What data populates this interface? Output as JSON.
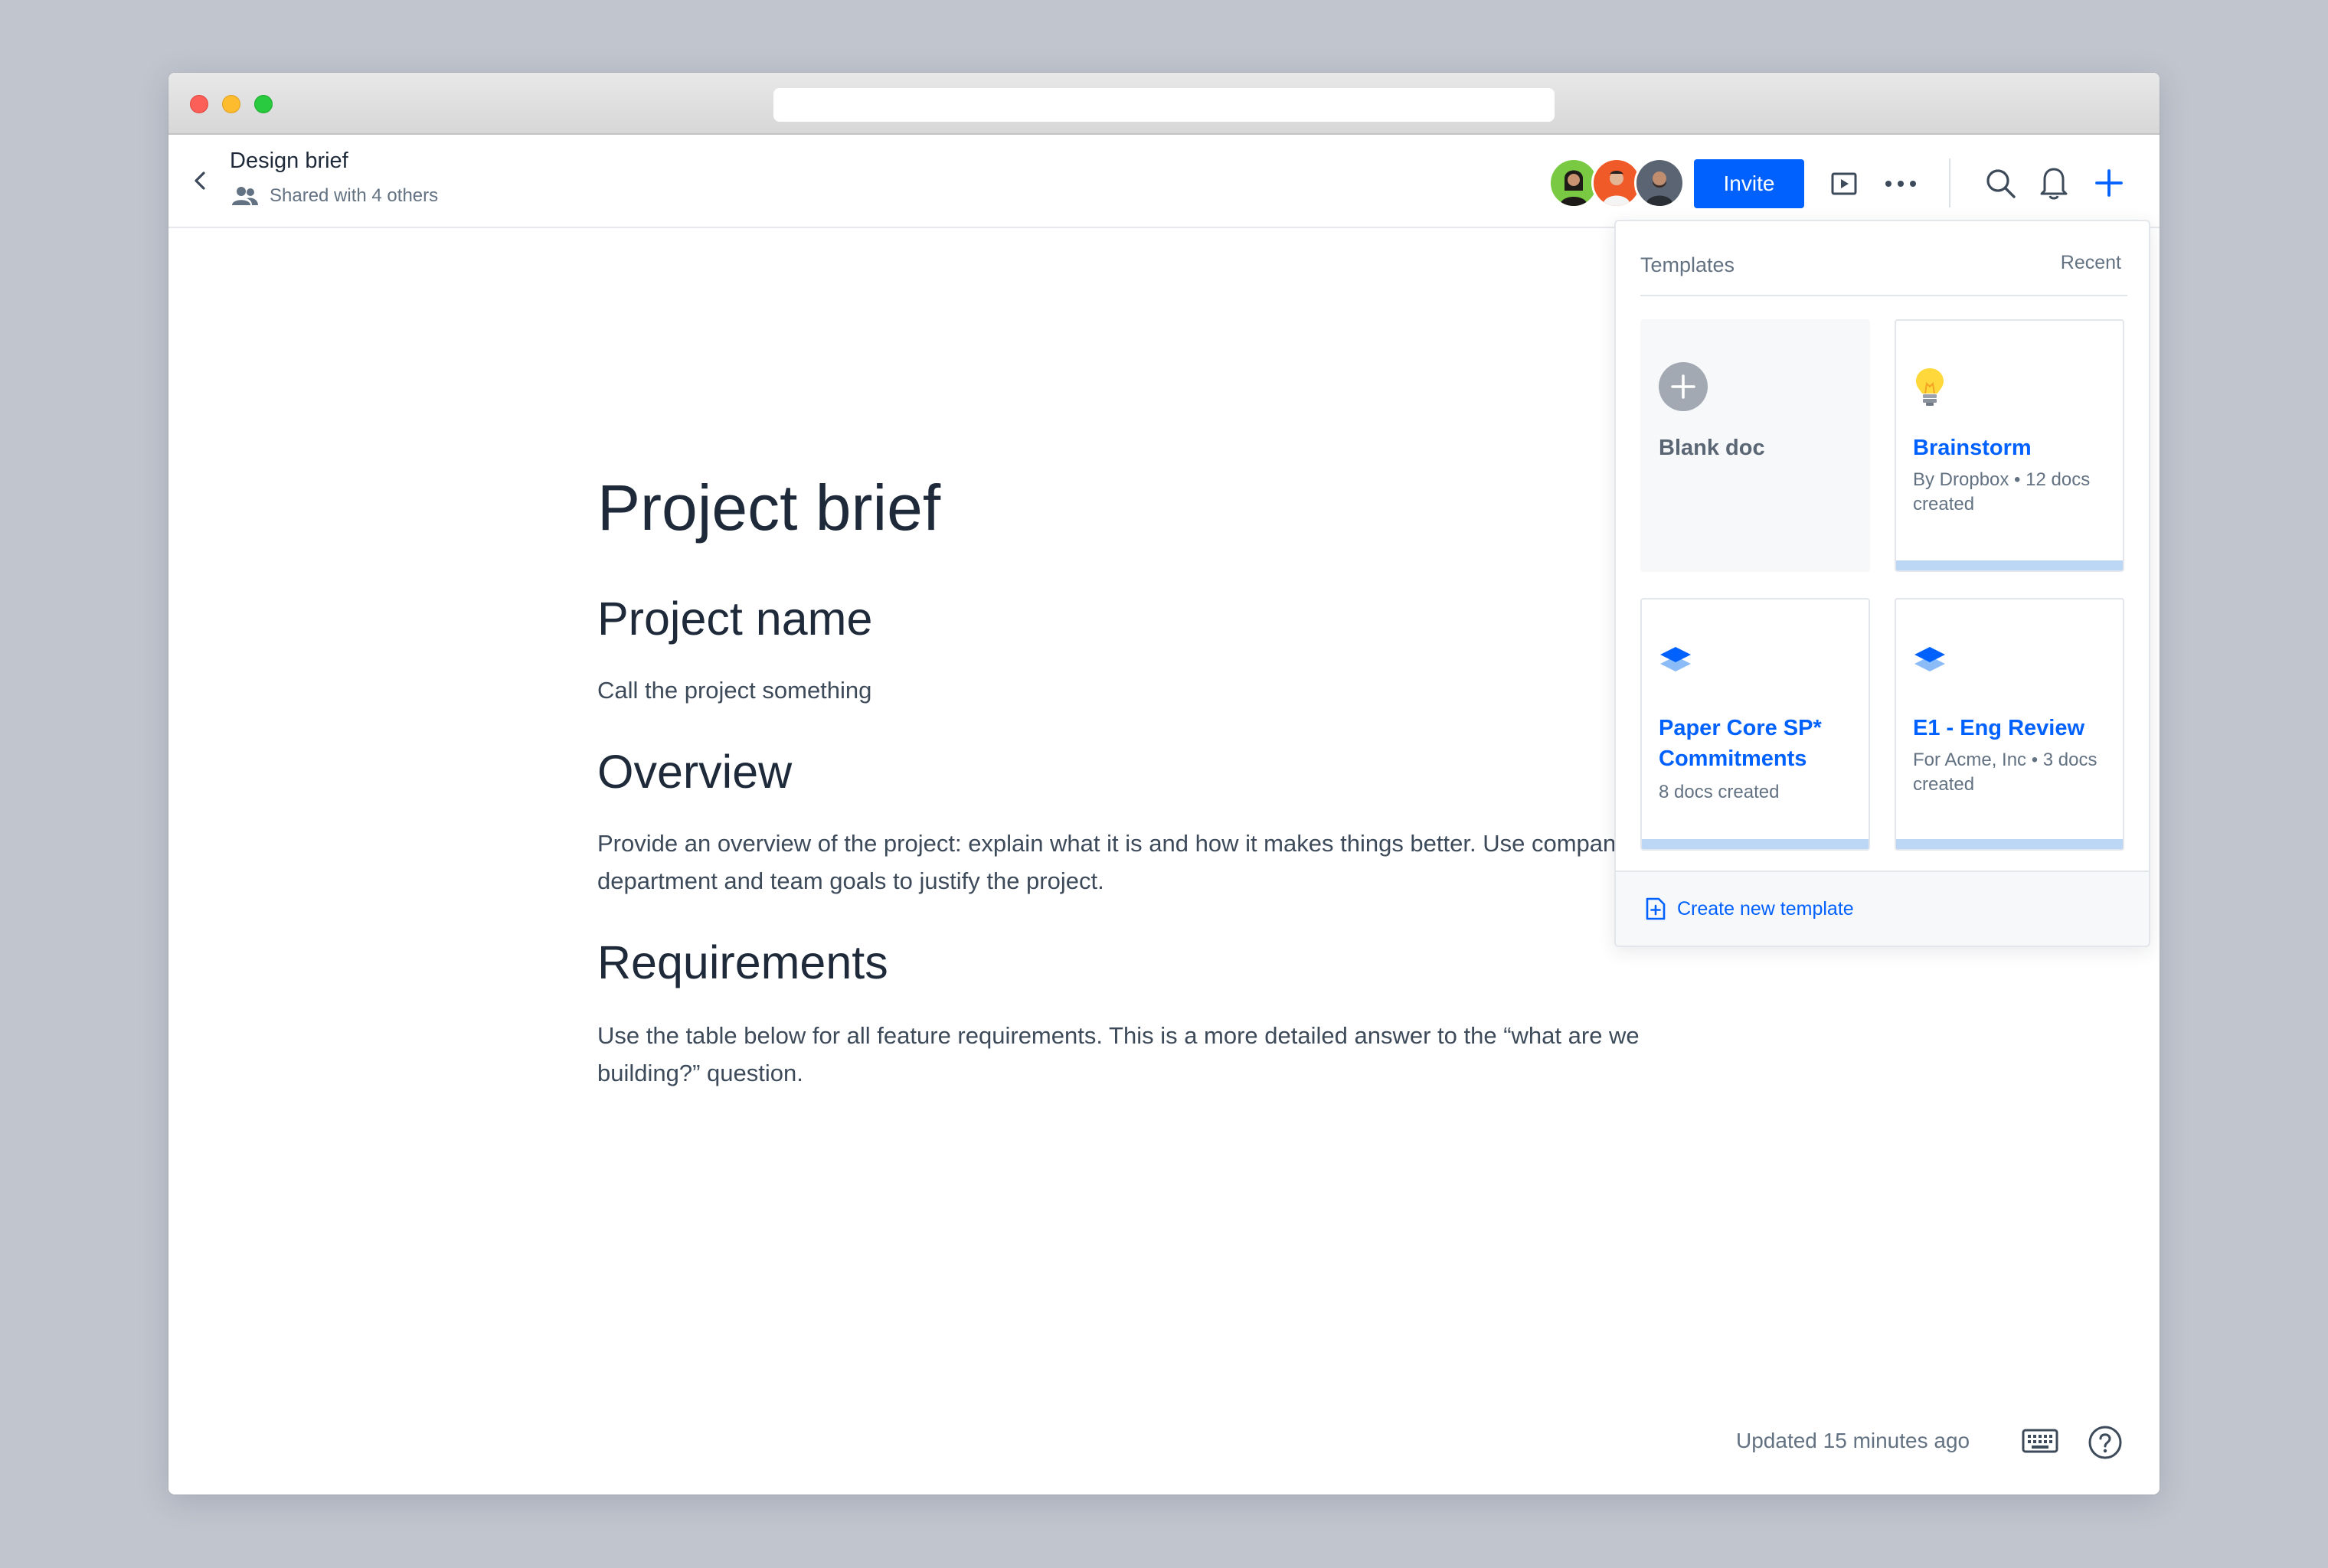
{
  "document": {
    "title": "Design brief",
    "shared_text": "Shared with 4 others"
  },
  "toolbar": {
    "invite_label": "Invite",
    "collaborators": [
      {
        "name": "collaborator-1",
        "color": "#7ac943"
      },
      {
        "name": "collaborator-2",
        "color": "#f05a28"
      },
      {
        "name": "collaborator-3",
        "color": "#5a6472"
      }
    ],
    "icons": [
      "back-icon",
      "people-icon",
      "present-icon",
      "more-icon",
      "search-icon",
      "bell-icon",
      "plus-icon"
    ]
  },
  "content": {
    "heading": "Project brief",
    "section1_title": "Project name",
    "section1_text": "Call the project something",
    "section2_title": "Overview",
    "section2_text": "Provide an overview of the project: explain what it is and how it makes things better. Use company / department and team goals to justify the project.",
    "section3_title": "Requirements",
    "section3_text": "Use the table below for all feature requirements. This is a more detailed answer to the “what are we building?” question."
  },
  "footer": {
    "updated_text": "Updated 15 minutes ago"
  },
  "templates_panel": {
    "tab_templates": "Templates",
    "tab_recent": "Recent",
    "cards": [
      {
        "title": "Blank doc",
        "meta": ""
      },
      {
        "title": "Brainstorm",
        "meta": "By Dropbox • 12 docs created"
      },
      {
        "title": "Paper Core SP* Commitments",
        "meta": "8 docs created"
      },
      {
        "title": "E1 - Eng Review",
        "meta": "For Acme, Inc • 3 docs created"
      }
    ],
    "create_label": "Create new template"
  },
  "colors": {
    "accent": "#0061fe",
    "background": "#c1c5ce",
    "card_bar": "#bcd6f6"
  }
}
